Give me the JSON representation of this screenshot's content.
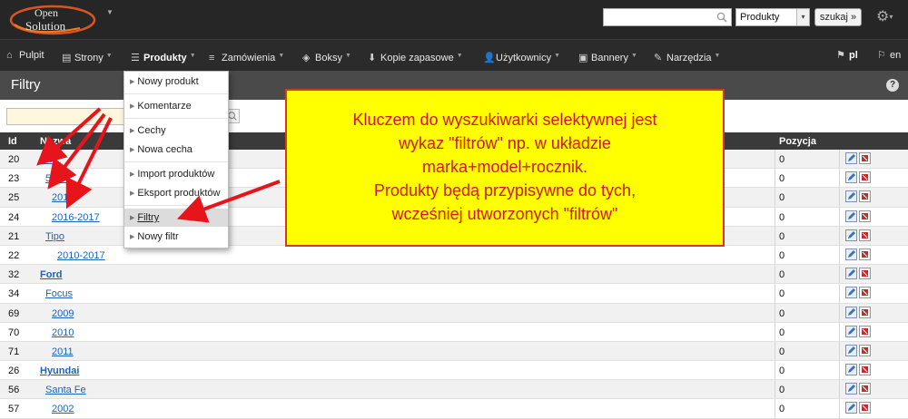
{
  "header": {
    "logo_line1": "Open",
    "logo_line2": "Solution",
    "search_placeholder": "",
    "search_scope": "Produkty",
    "search_button": "szukaj »"
  },
  "nav": [
    {
      "label": "Pulpit",
      "icon": "home-icon",
      "caret": false
    },
    {
      "label": "Strony",
      "icon": "document-icon",
      "caret": true
    },
    {
      "label": "Produkty",
      "icon": "list-icon",
      "caret": true
    },
    {
      "label": "Zamówienia",
      "icon": "cart-icon",
      "caret": true
    },
    {
      "label": "Boksy",
      "icon": "box-icon",
      "caret": true
    },
    {
      "label": "Kopie zapasowe",
      "icon": "download-icon",
      "caret": true
    },
    {
      "label": "Użytkownicy",
      "icon": "user-icon",
      "caret": true
    },
    {
      "label": "Bannery",
      "icon": "image-icon",
      "caret": true
    },
    {
      "label": "Narzędzia",
      "icon": "wrench-icon",
      "caret": true
    },
    {
      "label": "pl",
      "icon": "flag-icon",
      "caret": false
    },
    {
      "label": "en",
      "icon": "flag-icon",
      "caret": false
    }
  ],
  "page_title": "Filtry",
  "help_label": "?",
  "table": {
    "headers": {
      "id": "Id",
      "name": "Nazwa",
      "position": "Pozycja"
    },
    "rows": [
      {
        "id": "20",
        "name": "Fiat",
        "level": 0,
        "position": "0"
      },
      {
        "id": "23",
        "name": "500X",
        "level": 1,
        "position": "0"
      },
      {
        "id": "25",
        "name": "2015",
        "level": 2,
        "position": "0"
      },
      {
        "id": "24",
        "name": "2016-2017",
        "level": 2,
        "position": "0"
      },
      {
        "id": "21",
        "name": "Tipo",
        "level": 1,
        "position": "0"
      },
      {
        "id": "22",
        "name": "2010-2017",
        "level": 3,
        "position": "0"
      },
      {
        "id": "32",
        "name": "Ford",
        "level": 0,
        "position": "0"
      },
      {
        "id": "34",
        "name": "Focus",
        "level": 1,
        "position": "0"
      },
      {
        "id": "69",
        "name": "2009",
        "level": 2,
        "position": "0"
      },
      {
        "id": "70",
        "name": "2010",
        "level": 2,
        "position": "0"
      },
      {
        "id": "71",
        "name": "2011",
        "level": 2,
        "position": "0"
      },
      {
        "id": "26",
        "name": "Hyundai",
        "level": 0,
        "position": "0"
      },
      {
        "id": "56",
        "name": "Santa Fe",
        "level": 1,
        "position": "0"
      },
      {
        "id": "57",
        "name": "2002",
        "level": 2,
        "position": "0"
      }
    ]
  },
  "dropdown": {
    "groups": [
      [
        "Nowy produkt"
      ],
      [
        "Komentarze"
      ],
      [
        "Cechy",
        "Nowa cecha"
      ],
      [
        "Import produktów",
        "Eksport produktów"
      ],
      [
        "Filtry",
        "Nowy filtr"
      ]
    ],
    "selected": "Filtry"
  },
  "annotation": {
    "lines": [
      "Kluczem do wyszukiwarki selektywnej jest",
      "wykaz \"filtrów\"  np. w układzie",
      "marka+model+rocznik.",
      "Produkty będą przypisywne do tych,",
      "wcześniej utworzonych \"filtrów\""
    ]
  },
  "colors": {
    "header_bg": "#262626",
    "title_bg": "#4a4a4a",
    "link": "#1a63b8",
    "note_bg": "#ffff00",
    "note_text": "#d3171b",
    "arrow": "#e8141b"
  }
}
